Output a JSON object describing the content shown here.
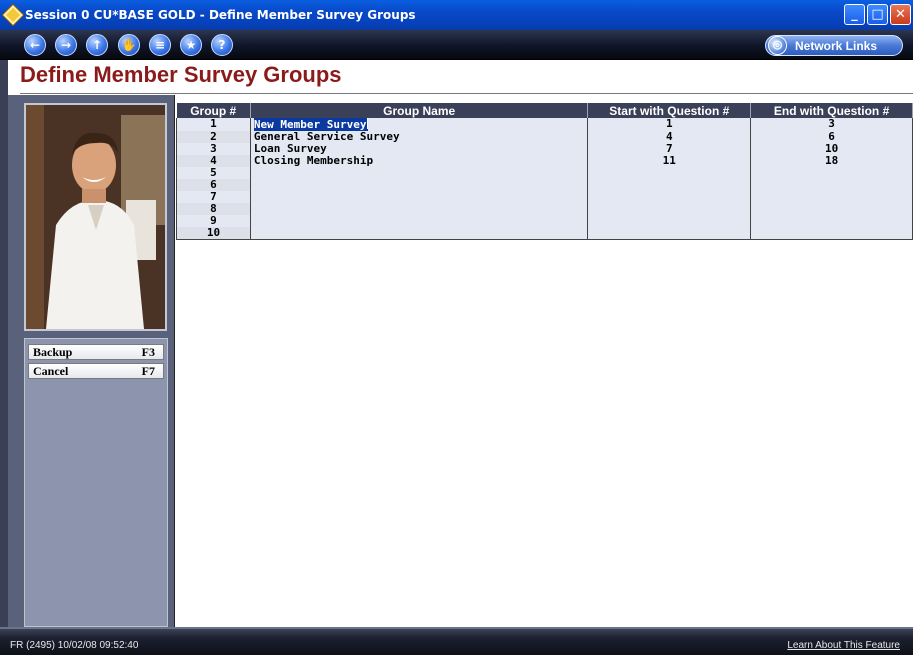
{
  "window": {
    "title": "Session 0 CU*BASE GOLD - Define Member Survey Groups",
    "min": "_",
    "max": "□",
    "close": "✕"
  },
  "toolbar": {
    "back": "←",
    "forward": "→",
    "up": "↑",
    "stop": "✋",
    "print": "≡",
    "favorites": "★",
    "help": "?",
    "network_links": "Network Links",
    "network_icon": "globe-icon"
  },
  "page": {
    "title": "Define Member Survey Groups"
  },
  "commands": [
    {
      "label": "Backup",
      "key": "F3"
    },
    {
      "label": "Cancel",
      "key": "F7"
    }
  ],
  "table": {
    "headers": [
      "Group #",
      "Group Name",
      "Start with Question #",
      "End with Question #"
    ],
    "rows": [
      {
        "group": "1",
        "name": "New Member Survey",
        "start": "1",
        "end": "3"
      },
      {
        "group": "2",
        "name": "General Service Survey",
        "start": "4",
        "end": "6"
      },
      {
        "group": "3",
        "name": "Loan Survey",
        "start": "7",
        "end": "10"
      },
      {
        "group": "4",
        "name": "Closing Membership",
        "start": "11",
        "end": "18"
      },
      {
        "group": "5",
        "name": "",
        "start": "",
        "end": ""
      },
      {
        "group": "6",
        "name": "",
        "start": "",
        "end": ""
      },
      {
        "group": "7",
        "name": "",
        "start": "",
        "end": ""
      },
      {
        "group": "8",
        "name": "",
        "start": "",
        "end": ""
      },
      {
        "group": "9",
        "name": "",
        "start": "",
        "end": ""
      },
      {
        "group": "10",
        "name": "",
        "start": "",
        "end": ""
      }
    ]
  },
  "status": {
    "left": "FR (2495) 10/02/08 09:52:40",
    "right": "Learn About This Feature"
  }
}
